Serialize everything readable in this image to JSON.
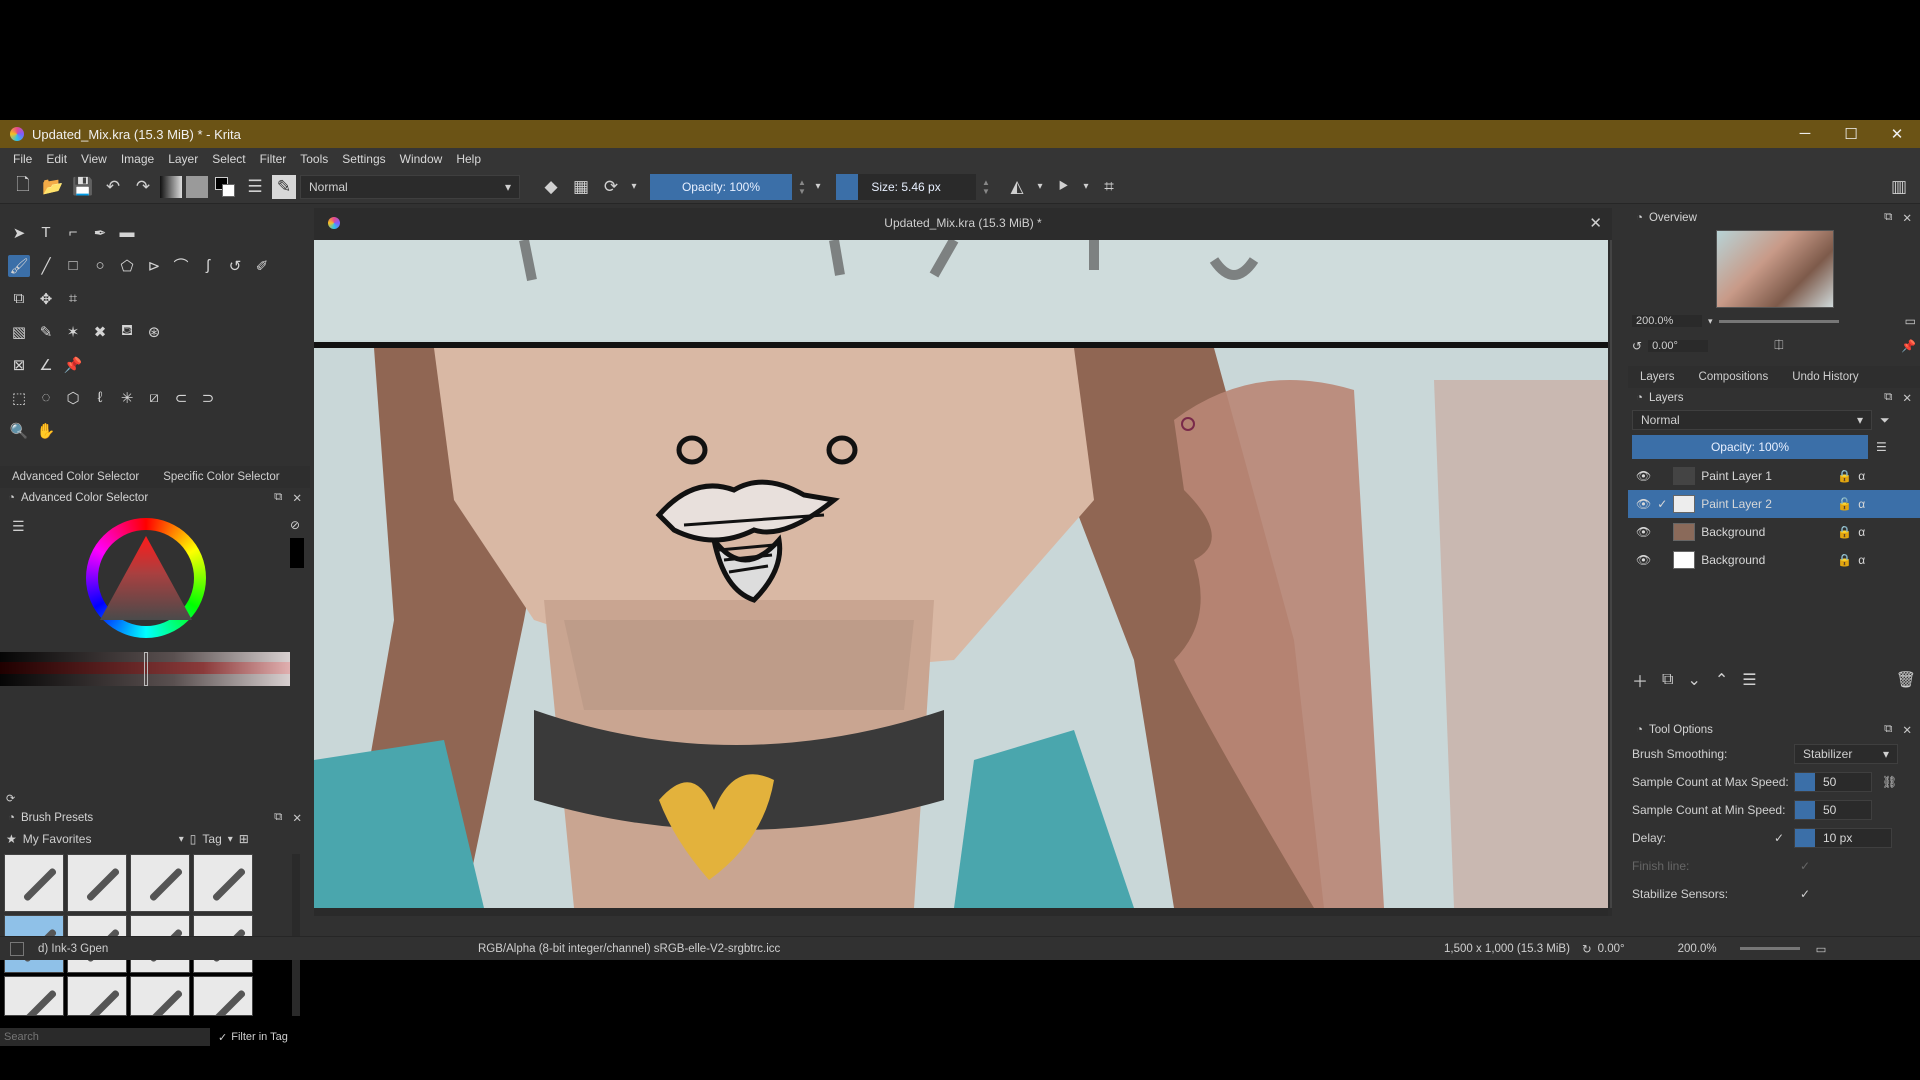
{
  "window": {
    "title": "Updated_Mix.kra (15.3 MiB) * - Krita",
    "minimize": "─",
    "maximize": "☐",
    "close": "✕"
  },
  "menu": [
    "File",
    "Edit",
    "View",
    "Image",
    "Layer",
    "Select",
    "Filter",
    "Tools",
    "Settings",
    "Window",
    "Help"
  ],
  "toolbar": {
    "blend_mode": "Normal",
    "opacity": "Opacity: 100%",
    "size": "Size: 5.46 px"
  },
  "left_dock": {
    "color_tabs": [
      "Advanced Color Selector",
      "Specific Color Selector"
    ],
    "color_dock_title": "Advanced Color Selector",
    "brush_dock_title": "Brush Presets",
    "brush_tag": "My Favorites",
    "tag_button": "Tag",
    "search_placeholder": "Search",
    "filter_in_tag": "Filter in Tag"
  },
  "canvas": {
    "document_tab": "Updated_Mix.kra (15.3 MiB) *",
    "colors": {
      "skin": "#d9b8a4",
      "hair": "#8a5a45",
      "teal": "#4aa6ad",
      "choker": "#3a3a3a",
      "heart": "#e3b23c",
      "sky": "#c9dcdd"
    }
  },
  "right_dock": {
    "overview_title": "Overview",
    "zoom": "200.0%",
    "rotation": "0.00°",
    "tabs": [
      "Layers",
      "Compositions",
      "Undo History"
    ],
    "layers_title": "Layers",
    "layer_blend": "Normal",
    "layer_opacity": "Opacity: 100%",
    "layers": [
      {
        "name": "Paint Layer 1",
        "selected": false
      },
      {
        "name": "Paint Layer 2",
        "selected": true
      },
      {
        "name": "Background",
        "selected": false
      },
      {
        "name": "Background",
        "selected": false
      }
    ],
    "tool_options_title": "Tool Options",
    "brush_smoothing_label": "Brush Smoothing:",
    "brush_smoothing_value": "Stabilizer",
    "max_speed_label": "Sample Count at Max Speed:",
    "max_speed_value": "50",
    "min_speed_label": "Sample Count at Min Speed:",
    "min_speed_value": "50",
    "delay_label": "Delay:",
    "delay_value": "10 px",
    "finish_line_label": "Finish line:",
    "stabilize_sensors_label": "Stabilize Sensors:"
  },
  "status": {
    "brush": "d) Ink-3 Gpen",
    "color_space": "RGB/Alpha (8-bit integer/channel)  sRGB-elle-V2-srgbtrc.icc",
    "dimensions": "1,500 x 1,000 (15.3 MiB)",
    "rotation": "0.00°",
    "zoom": "200.0%"
  }
}
